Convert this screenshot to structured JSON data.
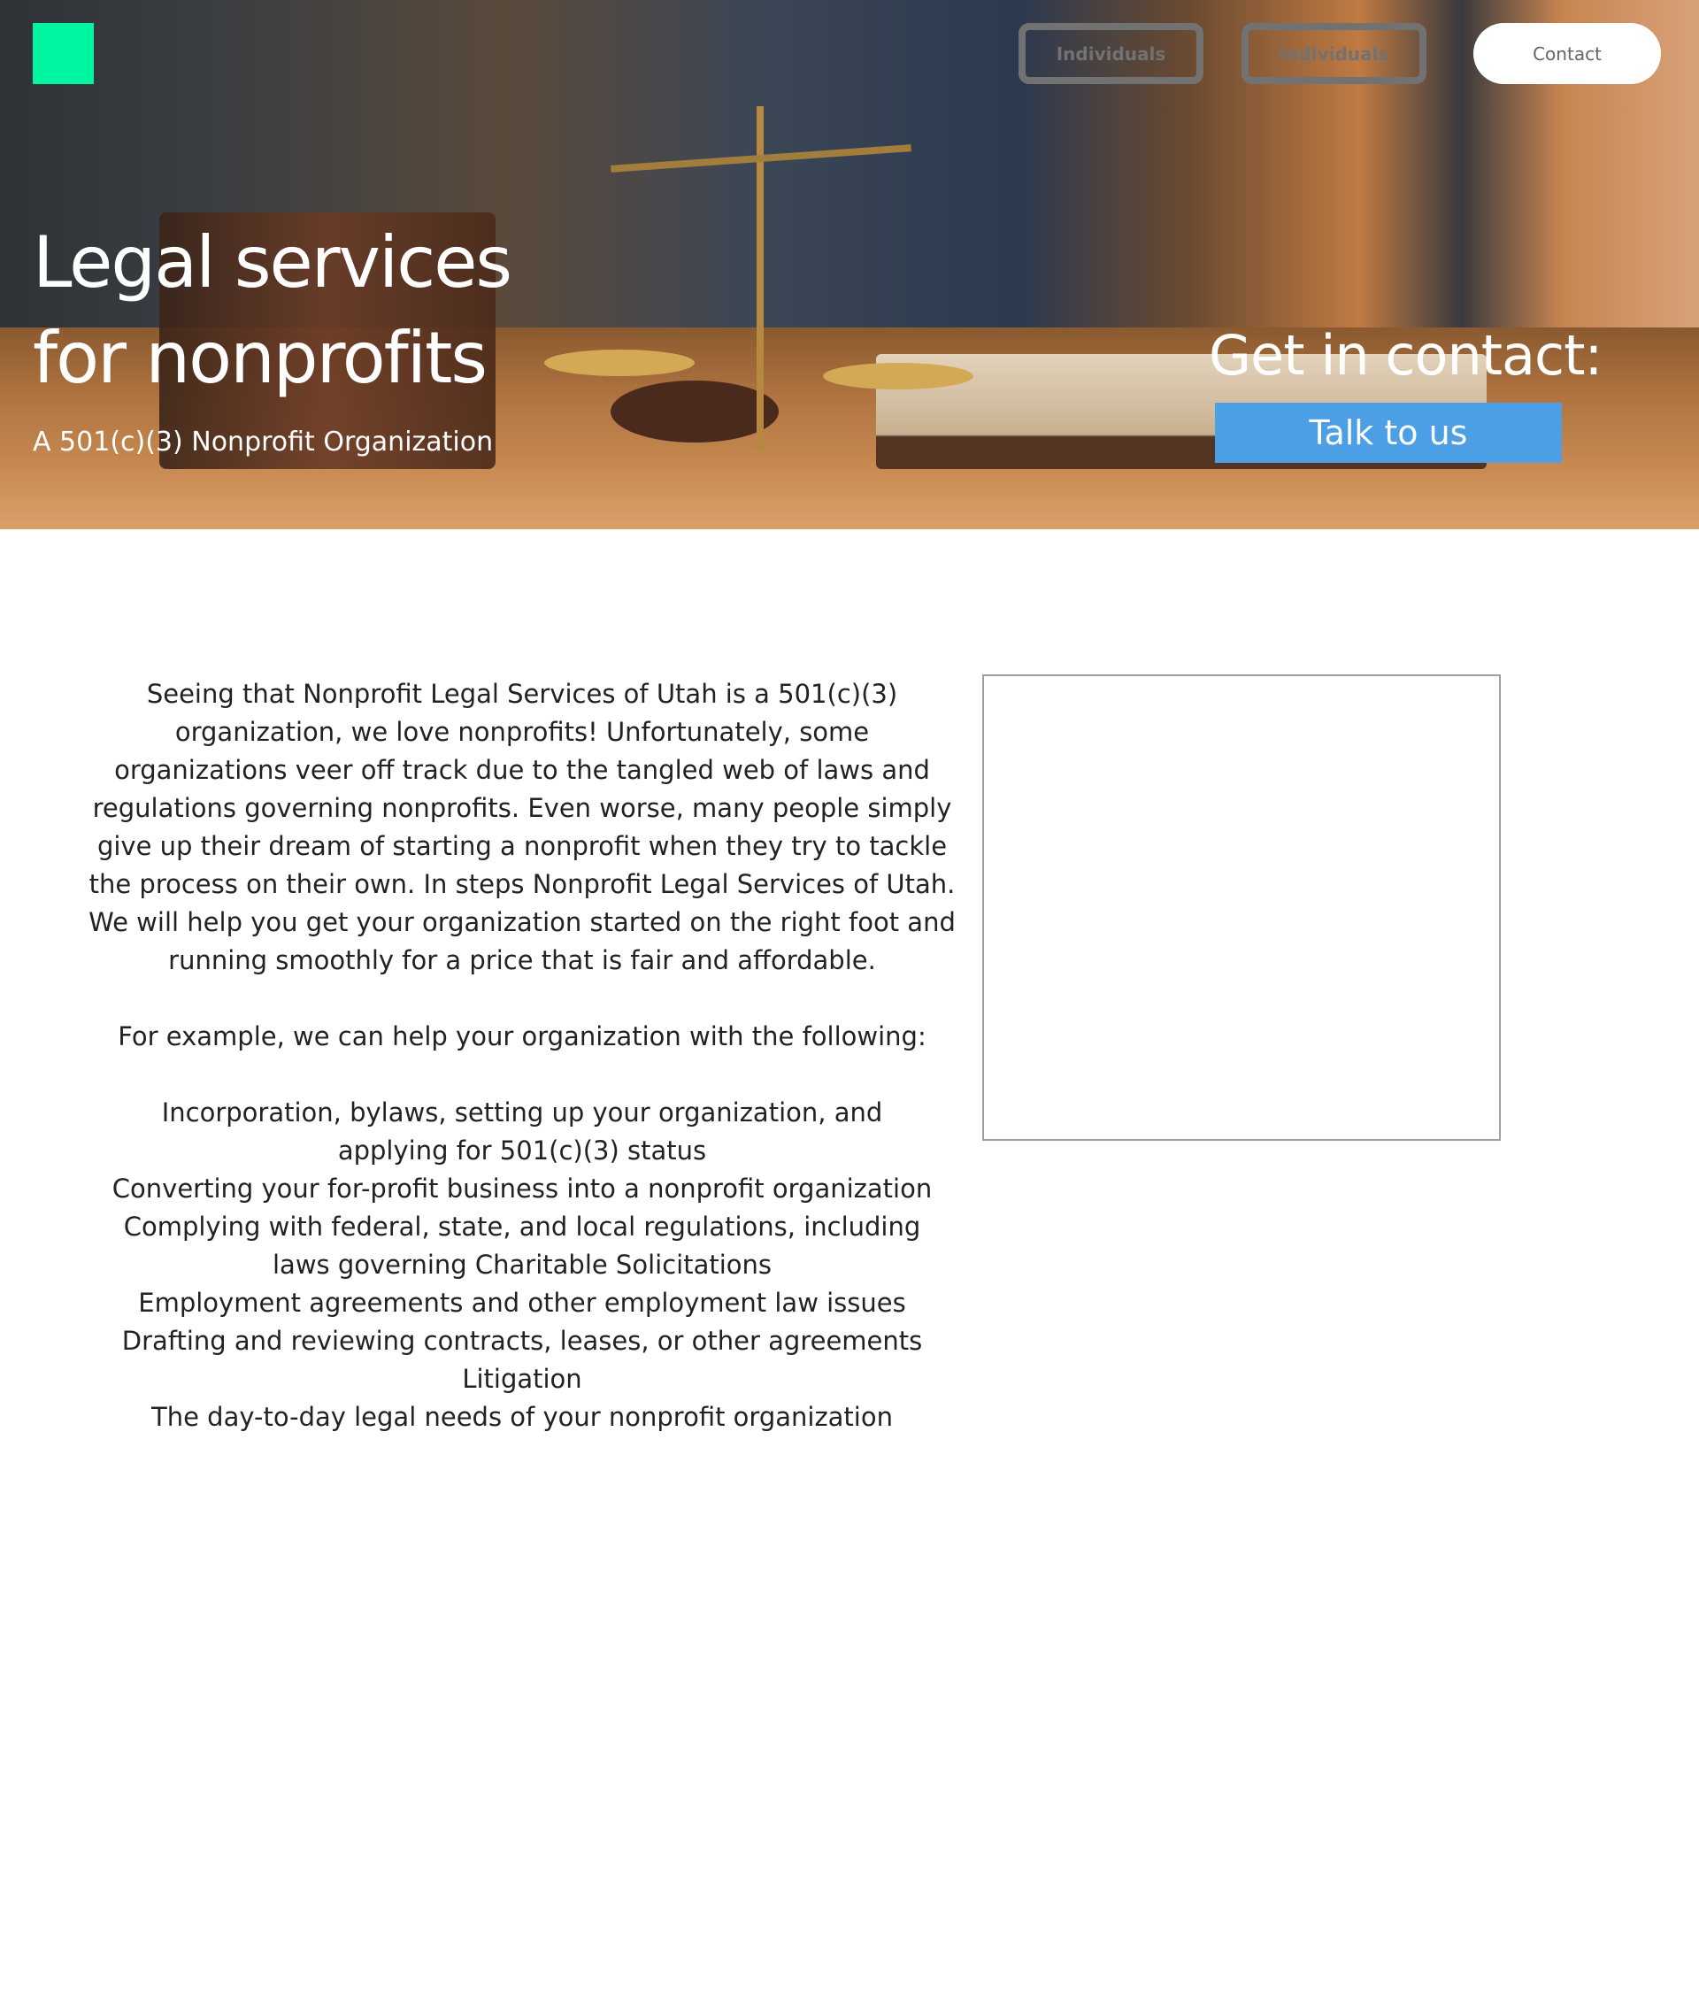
{
  "header": {
    "nav": [
      {
        "label": "Individuals"
      },
      {
        "label": "Individuals"
      }
    ],
    "contact_label": "Contact",
    "logo_color": "#00f5a0"
  },
  "hero": {
    "title_line1": "Legal services",
    "title_line2": "for nonprofits",
    "subtitle": "A 501(c)(3) Nonprofit Organization",
    "cta_heading": "Get in contact:",
    "cta_button": "Talk to us",
    "cta_color": "#4c9ee5"
  },
  "main": {
    "intro": "Seeing that Nonprofit Legal Services of Utah is a 501(c)(3) organization, we love nonprofits!   Unfortunately, some organizations veer off track due to the tangled web of laws and regulations governing nonprofits.  Even worse, many people simply give up their dream of starting a nonprofit when they try to tackle the process on their own.  In steps Nonprofit Legal Services of Utah. We will help you get your organization started on the right foot and running smoothly for a price that is fair and affordable.",
    "example_lead": "For example, we can help your organization with the following:",
    "services": [
      "Incorporation, bylaws, setting up your organization, and applying for 501(c)(3) status",
      "Converting your for-profit business into a nonprofit organization",
      "Complying with federal, state, and local regulations, including laws governing Charitable Solicitations",
      "Employment agreements and other employment law issues",
      "Drafting and reviewing contracts, leases, or other agreements",
      "Litigation",
      "The day-to-day legal needs of your nonprofit organization"
    ]
  }
}
